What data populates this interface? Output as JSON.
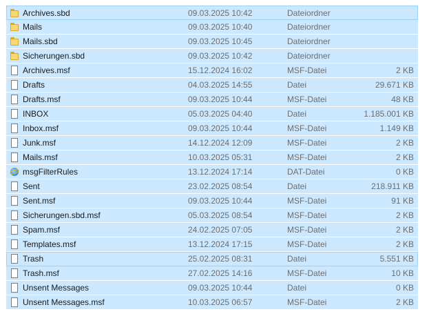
{
  "files": [
    {
      "name": "Archives.sbd",
      "date": "09.03.2025 10:42",
      "type": "Dateiordner",
      "size": "",
      "icon": "folder-icon"
    },
    {
      "name": "Mails",
      "date": "09.03.2025 10:40",
      "type": "Dateiordner",
      "size": "",
      "icon": "folder-icon"
    },
    {
      "name": "Mails.sbd",
      "date": "09.03.2025 10:45",
      "type": "Dateiordner",
      "size": "",
      "icon": "folder-icon"
    },
    {
      "name": "Sicherungen.sbd",
      "date": "09.03.2025 10:42",
      "type": "Dateiordner",
      "size": "",
      "icon": "folder-icon"
    },
    {
      "name": "Archives.msf",
      "date": "15.12.2024 16:02",
      "type": "MSF-Datei",
      "size": "2 KB",
      "icon": "file-icon"
    },
    {
      "name": "Drafts",
      "date": "04.03.2025 14:55",
      "type": "Datei",
      "size": "29.671 KB",
      "icon": "file-icon"
    },
    {
      "name": "Drafts.msf",
      "date": "09.03.2025 10:44",
      "type": "MSF-Datei",
      "size": "48 KB",
      "icon": "file-icon"
    },
    {
      "name": "INBOX",
      "date": "05.03.2025 04:40",
      "type": "Datei",
      "size": "1.185.001 KB",
      "icon": "file-icon"
    },
    {
      "name": "Inbox.msf",
      "date": "09.03.2025 10:44",
      "type": "MSF-Datei",
      "size": "1.149 KB",
      "icon": "file-icon"
    },
    {
      "name": "Junk.msf",
      "date": "14.12.2024 12:09",
      "type": "MSF-Datei",
      "size": "2 KB",
      "icon": "file-icon"
    },
    {
      "name": "Mails.msf",
      "date": "10.03.2025 05:31",
      "type": "MSF-Datei",
      "size": "2 KB",
      "icon": "file-icon"
    },
    {
      "name": "msgFilterRules",
      "date": "13.12.2024 17:14",
      "type": "DAT-Datei",
      "size": "0 KB",
      "icon": "browser-icon"
    },
    {
      "name": "Sent",
      "date": "23.02.2025 08:54",
      "type": "Datei",
      "size": "218.911 KB",
      "icon": "file-icon"
    },
    {
      "name": "Sent.msf",
      "date": "09.03.2025 10:44",
      "type": "MSF-Datei",
      "size": "91 KB",
      "icon": "file-icon"
    },
    {
      "name": "Sicherungen.sbd.msf",
      "date": "05.03.2025 08:54",
      "type": "MSF-Datei",
      "size": "2 KB",
      "icon": "file-icon"
    },
    {
      "name": "Spam.msf",
      "date": "24.02.2025 07:05",
      "type": "MSF-Datei",
      "size": "2 KB",
      "icon": "file-icon"
    },
    {
      "name": "Templates.msf",
      "date": "13.12.2024 17:15",
      "type": "MSF-Datei",
      "size": "2 KB",
      "icon": "file-icon"
    },
    {
      "name": "Trash",
      "date": "25.02.2025 08:31",
      "type": "Datei",
      "size": "5.551 KB",
      "icon": "file-icon"
    },
    {
      "name": "Trash.msf",
      "date": "27.02.2025 14:16",
      "type": "MSF-Datei",
      "size": "10 KB",
      "icon": "file-icon"
    },
    {
      "name": "Unsent Messages",
      "date": "09.03.2025 10:44",
      "type": "Datei",
      "size": "0 KB",
      "icon": "file-icon"
    },
    {
      "name": "Unsent Messages.msf",
      "date": "10.03.2025 06:57",
      "type": "MSF-Datei",
      "size": "2 KB",
      "icon": "file-icon"
    }
  ],
  "colors": {
    "selection": "#cce8ff",
    "selection_border": "#99d1ff",
    "secondary_text": "#6d6d6d"
  }
}
